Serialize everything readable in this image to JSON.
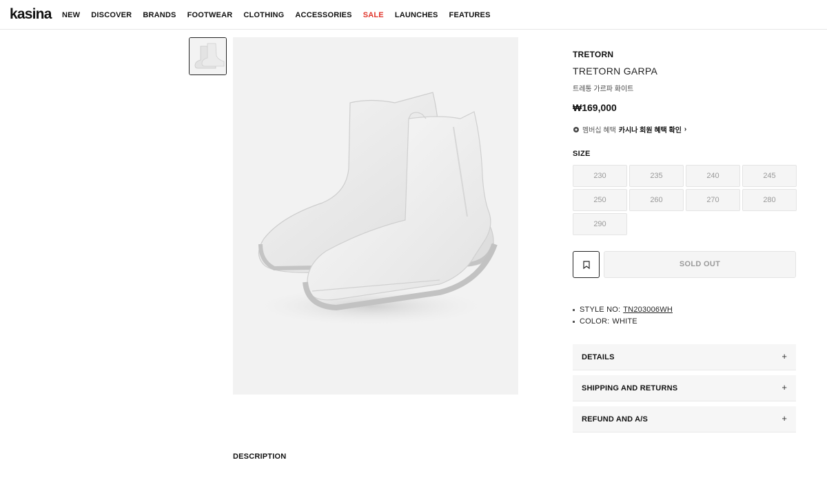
{
  "header": {
    "logo": "kasina",
    "nav": [
      "NEW",
      "DISCOVER",
      "BRANDS",
      "FOOTWEAR",
      "CLOTHING",
      "ACCESSORIES",
      "SALE",
      "LAUNCHES",
      "FEATURES"
    ],
    "sale_color": "#e0352b"
  },
  "product": {
    "brand": "TRETORN",
    "name": "TRETORN GARPA",
    "name_ko": "트레통 가르파 화이트",
    "price": "₩169,000",
    "membership_prefix": "멤버십 혜택",
    "membership_link": "카시나 회원 혜택 확인",
    "membership_arrow": "›",
    "size_label": "SIZE",
    "sizes": [
      "230",
      "235",
      "240",
      "245",
      "250",
      "260",
      "270",
      "280",
      "290"
    ],
    "soldout_label": "SOLD OUT",
    "style_no_label": "STYLE NO:",
    "style_no": "TN203006WH",
    "color_label": "COLOR:",
    "color_value": "WHITE"
  },
  "accordions": [
    "DETAILS",
    "SHIPPING AND RETURNS",
    "REFUND AND A/S"
  ],
  "accordion_icon": "+",
  "description_label": "DESCRIPTION"
}
